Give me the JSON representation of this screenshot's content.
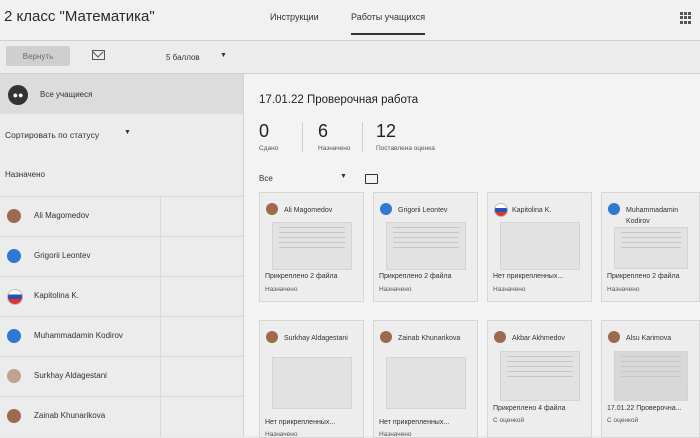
{
  "header": {
    "title": "2 класс \"Математика\"",
    "tabs": [
      {
        "label": "Инструкции"
      },
      {
        "label": "Работы учащихся"
      }
    ]
  },
  "toolbar": {
    "return_label": "Вернуть",
    "points_value": "5 баллов"
  },
  "sidebar": {
    "all_label": "Все учащиеся",
    "sort_label": "Сортировать по статусу",
    "group_label": "Назначено",
    "students": [
      {
        "name": "Ali Magomedov",
        "avatar": "photo"
      },
      {
        "name": "Grigorii Leontev",
        "avatar": "person-icon"
      },
      {
        "name": "Kapitolina K.",
        "avatar": "flag"
      },
      {
        "name": "Muhammadamin Kodirov",
        "avatar": "person-icon"
      },
      {
        "name": "Surkhay Aldagestani",
        "avatar": "photo"
      },
      {
        "name": "Zainab Khunarikova",
        "avatar": "photo"
      }
    ]
  },
  "main": {
    "assignment_title": "17.01.22 Проверочная работа",
    "stats": [
      {
        "value": "0",
        "label": "Сдано"
      },
      {
        "value": "6",
        "label": "Назначено"
      },
      {
        "value": "12",
        "label": "Поставлена оценка"
      }
    ],
    "filter_label": "Все",
    "cards": [
      {
        "name": "Ali Magomedov",
        "attachments": "Прикреплено 2 файла",
        "status": "Назначено"
      },
      {
        "name": "Grigorii Leontev",
        "attachments": "Прикреплено 2 файла",
        "status": "Назначено"
      },
      {
        "name": "Kapitolina K.",
        "attachments": "Нет прикрепленных...",
        "status": "Назначено"
      },
      {
        "name": "Muhammadamin Kodirov",
        "attachments": "Прикреплено 2 файла",
        "status": "Назначено"
      },
      {
        "name": "Surkhay Aldagestani",
        "attachments": "Нет прикрепленных...",
        "status": "Назначено"
      },
      {
        "name": "Zainab Khunarikova",
        "attachments": "Нет прикрепленных...",
        "status": "Назначено"
      },
      {
        "name": "Akbar Akhmedov",
        "attachments": "Прикреплено 4 файла",
        "status": "С оценкой"
      },
      {
        "name": "Alsu Karimova",
        "attachments": "17.01.22 Проверочна...",
        "status": "С оценкой"
      }
    ]
  }
}
